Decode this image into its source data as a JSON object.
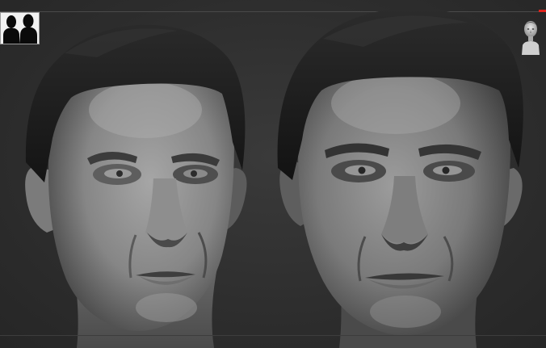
{
  "scene": {
    "background": "#2d2d2d",
    "accent": "#e0231c"
  },
  "icons": {
    "silhouette": "two-person-silhouette-icon",
    "nav_cube": "head-navigation-icon"
  },
  "models": [
    {
      "name": "sculpt-left",
      "skin": "#8c8c8c",
      "hair": "#1e1e1e"
    },
    {
      "name": "sculpt-right",
      "skin": "#838383",
      "hair": "#1a1a1a"
    }
  ]
}
